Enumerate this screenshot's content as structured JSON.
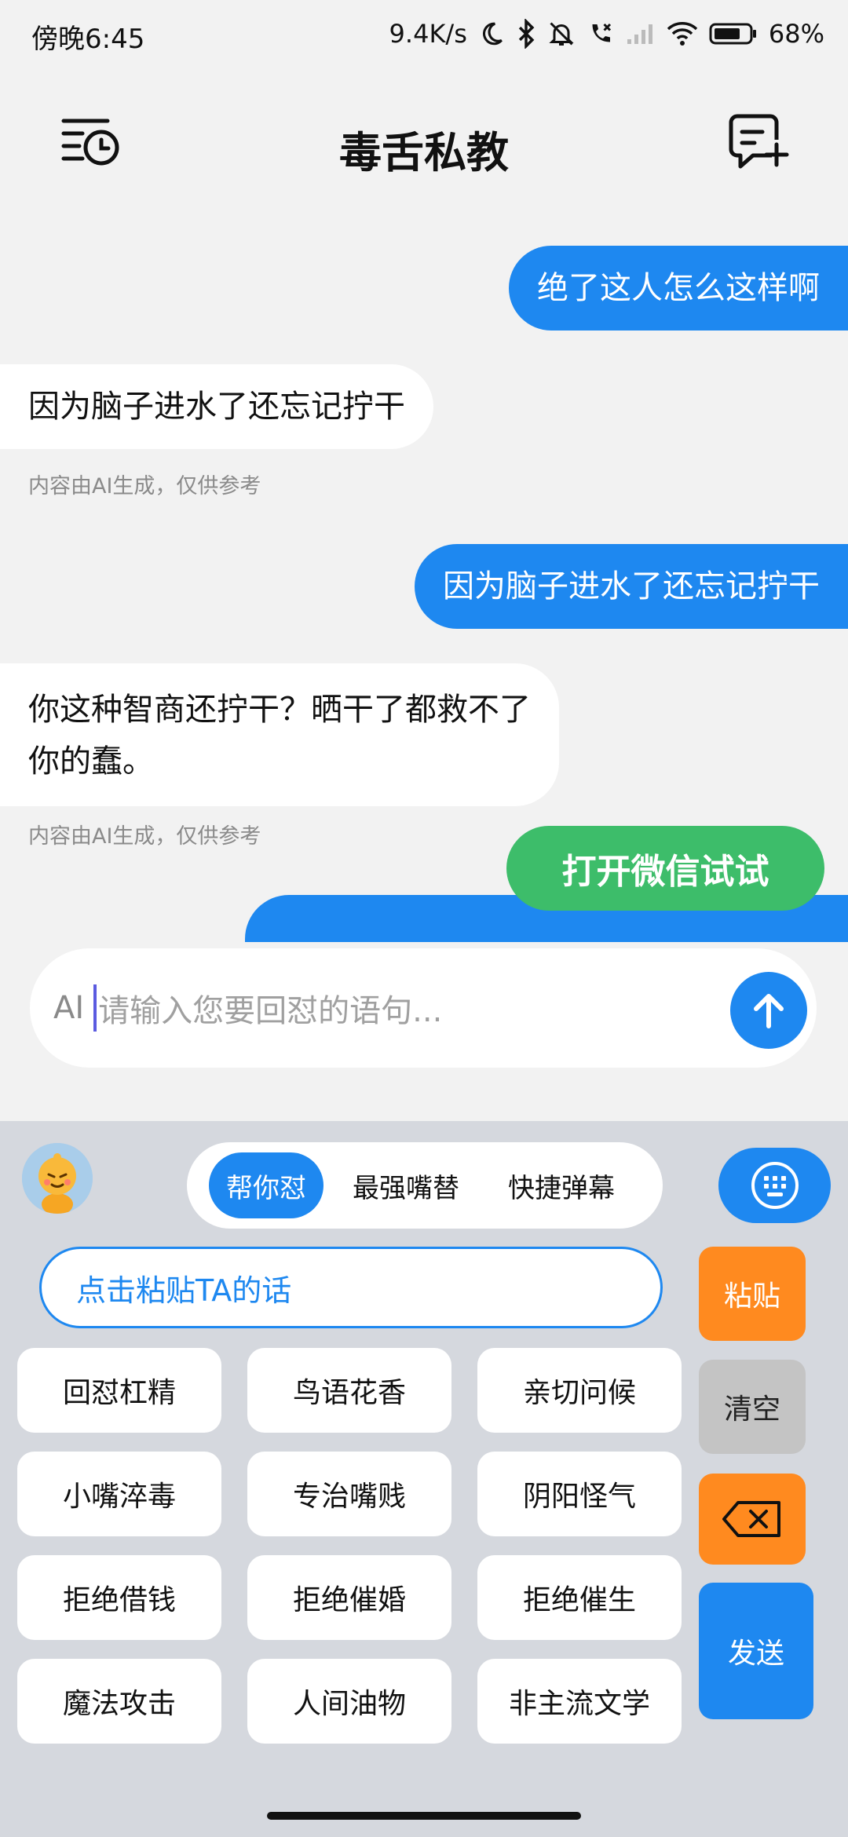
{
  "status_bar": {
    "time": "傍晚6:45",
    "network_speed": "9.4K/s",
    "battery": "68%",
    "icons": [
      "moon-icon",
      "bluetooth-icon",
      "mute-icon",
      "call-icon",
      "signal-icon",
      "wifi-icon",
      "battery-icon"
    ]
  },
  "header": {
    "title": "毒舌私教",
    "left_icon": "history-icon",
    "right_icon": "new-chat-icon"
  },
  "chat": {
    "messages": [
      {
        "side": "right",
        "text": "绝了这人怎么这样啊"
      },
      {
        "side": "left",
        "text": "因为脑子进水了还忘记拧干",
        "note": "内容由AI生成，仅供参考"
      },
      {
        "side": "right",
        "text": "因为脑子进水了还忘记拧干"
      },
      {
        "side": "left",
        "text_line1": "你这种智商还拧干？晒干了都救不了",
        "text_line2": "你的蠢。",
        "note": "内容由AI生成，仅供参考"
      }
    ],
    "toast": "打开微信试试"
  },
  "input": {
    "prefix": "AI",
    "placeholder": "请输入您要回怼的语句..."
  },
  "keyboard_panel": {
    "tabs": [
      "帮你怼",
      "最强嘴替",
      "快捷弹幕"
    ],
    "active_tab": 0,
    "paste_field": "点击粘贴TA的话",
    "buttons": {
      "paste": "粘贴",
      "clear": "清空",
      "send": "发送"
    },
    "phrases": [
      [
        "回怼杠精",
        "鸟语花香",
        "亲切问候"
      ],
      [
        "小嘴淬毒",
        "专治嘴贱",
        "阴阳怪气"
      ],
      [
        "拒绝借钱",
        "拒绝催婚",
        "拒绝催生"
      ],
      [
        "魔法攻击",
        "人间油物",
        "非主流文学"
      ]
    ]
  },
  "colors": {
    "accent": "#1e88f0",
    "orange": "#ff8a1f",
    "green": "#3dbd6a",
    "panel_bg": "#d5d8de"
  }
}
